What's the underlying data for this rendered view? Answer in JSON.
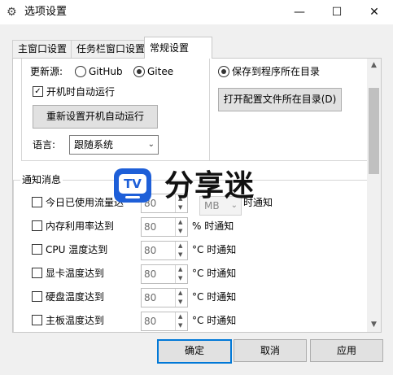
{
  "window": {
    "title": "选项设置",
    "icon": "gear-icon",
    "controls": {
      "minimize": "—",
      "maximize": "☐",
      "close": "✕"
    }
  },
  "tabs": [
    {
      "label": "主窗口设置",
      "selected": false
    },
    {
      "label": "任务栏窗口设置",
      "selected": false
    },
    {
      "label": "常规设置",
      "selected": true
    }
  ],
  "update_source": {
    "label": "更新源:",
    "options": [
      "GitHub",
      "Gitee"
    ],
    "selected": "Gitee"
  },
  "autostart": {
    "label": "开机时自动运行",
    "checked": true
  },
  "reset_autostart_button": "重新设置开机自动运行",
  "language": {
    "label": "语言:",
    "value": "跟随系统"
  },
  "config_location": {
    "radio_label": "保存到程序所在目录",
    "selected": true,
    "open_button": "打开配置文件所在目录(D)"
  },
  "notify": {
    "title": "通知消息",
    "rows": [
      {
        "label": "今日已使用流量达",
        "value": "80",
        "unit_select": "MB",
        "suffix": "时通知",
        "checked": false
      },
      {
        "label": "内存利用率达到",
        "value": "80",
        "suffix": "% 时通知",
        "checked": false
      },
      {
        "label": "CPU 温度达到",
        "value": "80",
        "suffix": "°C 时通知",
        "checked": false
      },
      {
        "label": "显卡温度达到",
        "value": "80",
        "suffix": "°C 时通知",
        "checked": false
      },
      {
        "label": "硬盘温度达到",
        "value": "80",
        "suffix": "°C 时通知",
        "checked": false
      },
      {
        "label": "主板温度达到",
        "value": "80",
        "suffix": "°C 时通知",
        "checked": false
      }
    ]
  },
  "watermark": {
    "badge": "TV",
    "text": "分享迷"
  },
  "footer": {
    "ok": "确定",
    "cancel": "取消",
    "apply": "应用"
  }
}
